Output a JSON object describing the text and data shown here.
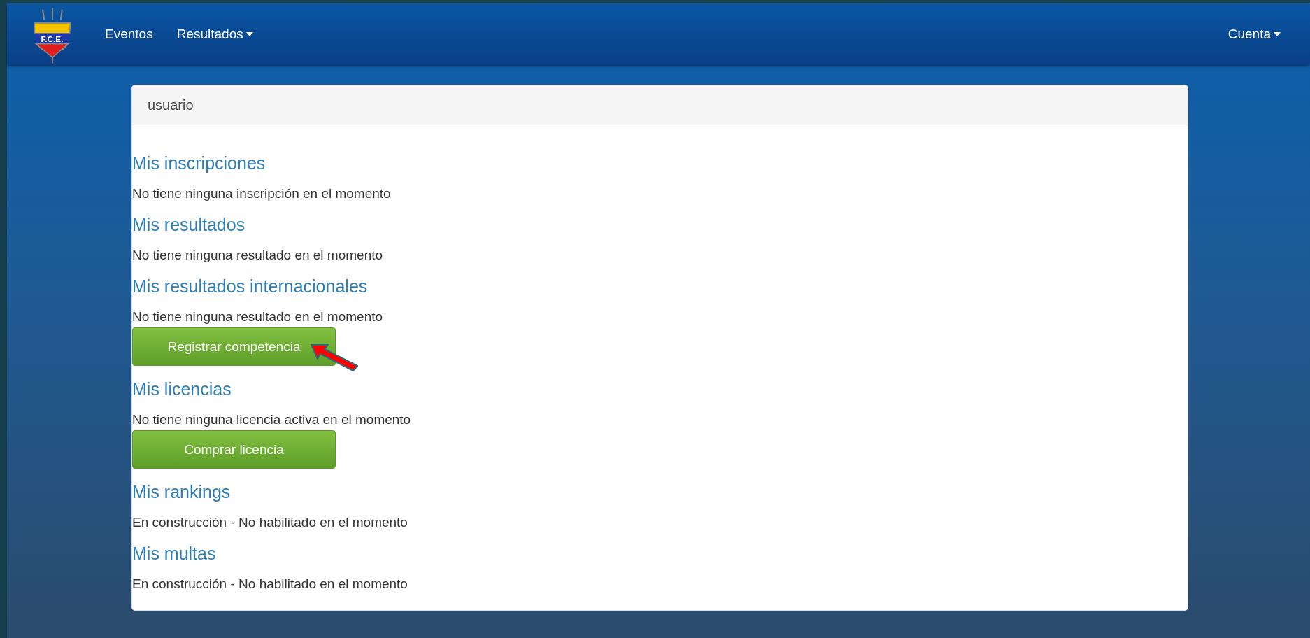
{
  "navbar": {
    "logo_text": "F.C.E.",
    "items": [
      {
        "label": "Eventos",
        "dropdown": false
      },
      {
        "label": "Resultados",
        "dropdown": true
      }
    ],
    "account": {
      "label": "Cuenta",
      "dropdown": true
    }
  },
  "panel": {
    "title": "usuario",
    "sections": [
      {
        "heading": "Mis inscripciones",
        "message": "No tiene ninguna inscripción en el momento"
      },
      {
        "heading": "Mis resultados",
        "message": "No tiene ninguna resultado en el momento"
      },
      {
        "heading": "Mis resultados internacionales",
        "message": "No tiene ninguna resultado en el momento",
        "button": {
          "label": "Registrar competencia",
          "highlighted": true
        }
      },
      {
        "heading": "Mis licencias",
        "message": "No tiene ninguna licencia activa en el momento",
        "button": {
          "label": "Comprar licencia",
          "highlighted": false
        }
      },
      {
        "heading": "Mis rankings",
        "message": "En construcción - No habilitado en el momento"
      },
      {
        "heading": "Mis multas",
        "message": "En construcción - No habilitado en el momento"
      }
    ]
  }
}
